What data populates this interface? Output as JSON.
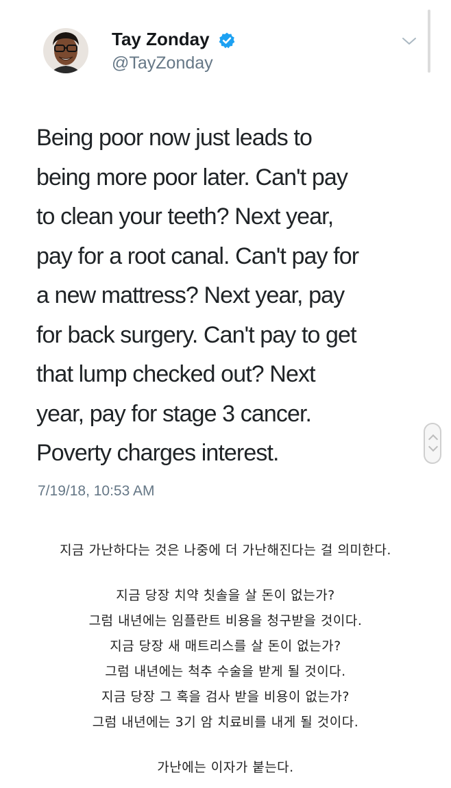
{
  "tweet": {
    "display_name": "Tay Zonday",
    "handle": "@TayZonday",
    "verified": true,
    "lines": [
      "Being poor now just leads to",
      "being more poor later. Can't pay",
      "to clean your teeth? Next year,",
      "pay for a root canal. Can't pay for",
      "a new mattress? Next year, pay",
      "for back surgery. Can't pay to get",
      "that lump checked out? Next",
      "year, pay for stage 3 cancer.",
      "Poverty charges interest."
    ],
    "timestamp": "7/19/18, 10:53 AM",
    "icons": {
      "verified": "verified-badge-icon",
      "menu": "chevron-down-icon"
    },
    "colors": {
      "verified": "#1da1f2",
      "secondary_text": "#657786"
    }
  },
  "translation": {
    "headline": "지금 가난하다는 것은 나중에 더 가난해진다는 걸 의미한다.",
    "lines": [
      "지금 당장 치약 칫솔을 살 돈이 없는가?",
      "그럼 내년에는 임플란트 비용을 청구받을 것이다.",
      "지금 당장 새 매트리스를 살 돈이 없는가?",
      "그럼 내년에는 척추 수술을 받게 될 것이다.",
      "지금 당장 그 혹을 검사 받을 비용이 없는가?",
      "그럼 내년에는 3기 암 치료비를 내게 될 것이다."
    ],
    "closing": "가난에는 이자가 붙는다."
  }
}
